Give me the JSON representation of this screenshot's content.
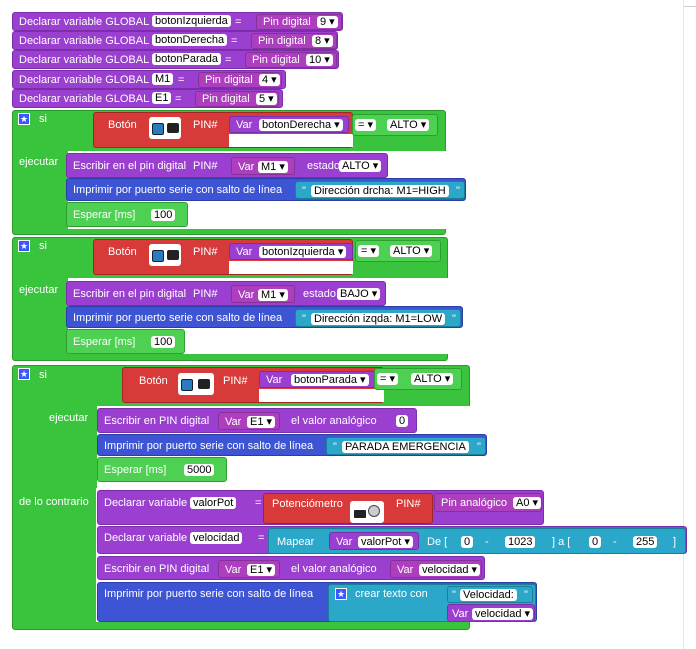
{
  "globals": [
    {
      "label": "Declarar variable GLOBAL",
      "name": "botonIzquierda",
      "op": "=",
      "value_label": "Pin digital",
      "pin": "9 ▾"
    },
    {
      "label": "Declarar variable GLOBAL",
      "name": "botonDerecha",
      "op": "=",
      "value_label": "Pin digital",
      "pin": "8 ▾"
    },
    {
      "label": "Declarar variable GLOBAL",
      "name": "botonParada",
      "op": "=",
      "value_label": "Pin digital",
      "pin": "10 ▾"
    },
    {
      "label": "Declarar variable GLOBAL",
      "name": "M1",
      "op": "=",
      "value_label": "Pin digital",
      "pin": "4 ▾"
    },
    {
      "label": "Declarar variable GLOBAL",
      "name": "E1",
      "op": "=",
      "value_label": "Pin digital",
      "pin": "5 ▾"
    }
  ],
  "if1": {
    "si": "si",
    "ejecutar": "ejecutar",
    "boton": "Botón",
    "pin_label": "PIN#",
    "var_label": "Var",
    "var": "botonDerecha ▾",
    "op": "= ▾",
    "alto": "ALTO ▾",
    "write": {
      "label": "Escribir en el pin digital",
      "pin_label": "PIN#",
      "var_label": "Var",
      "var": "M1 ▾",
      "estado_label": "estado",
      "estado": "ALTO ▾"
    },
    "print": {
      "label": "Imprimir por puerto serie con salto de línea",
      "q1": "\"",
      "text": "Dirección drcha: M1=HIGH",
      "q2": "\""
    },
    "wait": {
      "label": "Esperar [ms]",
      "value": "100"
    }
  },
  "if2": {
    "si": "si",
    "ejecutar": "ejecutar",
    "boton": "Botón",
    "pin_label": "PIN#",
    "var_label": "Var",
    "var": "botonIzquierda ▾",
    "op": "= ▾",
    "alto": "ALTO ▾",
    "write": {
      "label": "Escribir en el pin digital",
      "pin_label": "PIN#",
      "var_label": "Var",
      "var": "M1 ▾",
      "estado_label": "estado",
      "estado": "BAJO ▾"
    },
    "print": {
      "label": "Imprimir por puerto serie con salto de línea",
      "q1": "\"",
      "text": "Dirección izqda: M1=LOW",
      "q2": "\""
    },
    "wait": {
      "label": "Esperar [ms]",
      "value": "100"
    }
  },
  "if3": {
    "si": "si",
    "ejecutar": "ejecutar",
    "else": "de lo contrario",
    "boton": "Botón",
    "pin_label": "PIN#",
    "var_label": "Var",
    "var": "botonParada ▾",
    "op": "= ▾",
    "alto": "ALTO ▾",
    "analog": {
      "label": "Escribir en PIN digital",
      "var_label": "Var",
      "var": "E1 ▾",
      "value_label": "el valor analógico",
      "value": "0"
    },
    "print": {
      "label": "Imprimir por puerto serie con salto de línea",
      "q1": "\"",
      "text": "PARADA EMERGENCIA",
      "q2": "\""
    },
    "wait": {
      "label": "Esperar [ms]",
      "value": "5000"
    },
    "decl1": {
      "label": "Declarar variable",
      "name": "valorPot",
      "op": "=",
      "sensor": "Potenciómetro",
      "pin_label": "PIN#",
      "analog_label": "Pin analógico",
      "analog": "A0 ▾"
    },
    "decl2": {
      "label": "Declarar variable",
      "name": "velocidad",
      "op": "=",
      "map": "Mapear",
      "var_label": "Var",
      "var": "valorPot ▾",
      "de": "De [",
      "v1": "0",
      "dash": "-",
      "v2": "1023",
      "a": "]  a [",
      "v3": "0",
      "dash2": "-",
      "v4": "255",
      "end": "]"
    },
    "write2": {
      "label": "Escribir en PIN digital",
      "var_label": "Var",
      "var": "E1 ▾",
      "value_label": "el valor analógico",
      "var2_label": "Var",
      "var2": "velocidad ▾"
    },
    "print2": {
      "label": "Imprimir por puerto serie con salto de línea",
      "create": "crear texto con",
      "q1": "\"",
      "text": "Velocidad:",
      "q2": "\"",
      "var_label": "Var",
      "var": "velocidad ▾"
    }
  },
  "colors": {
    "purple": "#9b3fd0",
    "green": "#3ac43e",
    "red": "#d83a3a",
    "blue": "#3d55d4",
    "teal": "#2aa7c9"
  }
}
